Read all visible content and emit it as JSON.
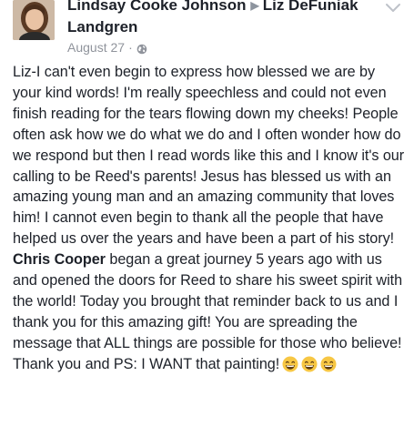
{
  "post": {
    "author": "Lindsay Cooke Johnson",
    "recipient": "Liz DeFuniak Landgren",
    "date": "August 27",
    "privacy_icon": "globe-icon",
    "menu_icon": "chevron-down-icon",
    "body": {
      "part1": "Liz-I can't even begin to express how blessed we are by your kind words! I'm really speechless and could not even finish reading for the tears flowing down my cheeks! People often ask how we do what we do and I often wonder how do we respond but then I read words like this and I know it's our calling to be Reed's parents! Jesus has blessed us with an amazing young man and an amazing community that loves him! I cannot even begin to thank all the people that have helped us over the years and have been a part of his story! ",
      "mention": "Chris Cooper",
      "part2": " began a great journey 5 years ago with us and opened the doors for Reed to share his sweet spirit with the world! Today you brought that reminder back to us and I thank you for this amazing gift! You are spreading the message that ALL things are possible for those who believe! Thank you and PS: I WANT that painting!",
      "emojis": [
        "grinning-face-icon",
        "grinning-face-icon",
        "grinning-face-icon"
      ]
    }
  },
  "colors": {
    "name_text": "#1d2129",
    "meta_text": "#90949c",
    "emoji_face": "#f7c744"
  }
}
